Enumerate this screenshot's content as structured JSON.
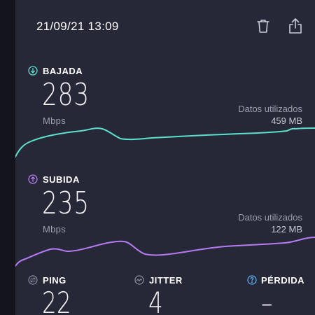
{
  "header": {
    "timestamp": "21/09/21 13:09",
    "delete_icon": "trash-icon",
    "share_icon": "share-icon"
  },
  "download": {
    "label": "BAJADA",
    "value": "283",
    "unit": "Mbps",
    "data_used_label": "Datos utilizados",
    "data_used_value": "459 MB",
    "color": "#5ee0cf",
    "icon": "arrow-down-circle-icon"
  },
  "upload": {
    "label": "SUBIDA",
    "value": "235",
    "unit": "Mbps",
    "data_used_label": "Datos utilizados",
    "data_used_value": "122 MB",
    "color": "#b67bf2",
    "icon": "arrow-up-circle-icon"
  },
  "ping": {
    "label": "PING",
    "value": "22",
    "icon": "ping-icon"
  },
  "jitter": {
    "label": "JITTER",
    "value": "4",
    "icon": "jitter-icon"
  },
  "loss": {
    "label": "PÉRDIDA",
    "value": "–",
    "icon": "question-circle-icon",
    "color": "#5fb8ff"
  }
}
